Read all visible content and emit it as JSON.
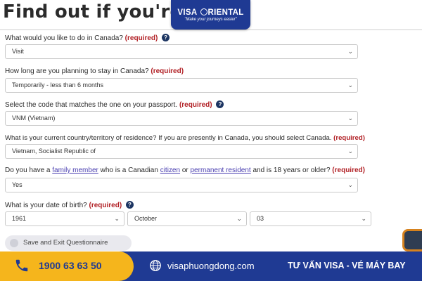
{
  "title": "Find out if you're eligib",
  "logo": {
    "name_part1": "VISA ",
    "name_part2": "RIENTAL",
    "tagline": "\"Make your journeys easier\""
  },
  "required_label": "(required)",
  "questions": [
    {
      "text": "What would you like to do in Canada?",
      "help": true,
      "value": "Visit"
    },
    {
      "text": "How long are you planning to stay in Canada?",
      "help": false,
      "value": "Temporarily - less than 6 months"
    },
    {
      "text": "Select the code that matches the one on your passport.",
      "help": true,
      "value": "VNM (Vietnam)"
    },
    {
      "text": "What is your current country/territory of residence? If you are presently in Canada, you should select Canada.",
      "help": false,
      "value": "Vietnam, Socialist Republic of"
    },
    {
      "text_parts": [
        "Do you have a ",
        "family member",
        " who is a Canadian ",
        "citizen",
        " or ",
        "permanent resident",
        " and is 18 years or older?"
      ],
      "help": false,
      "value": "Yes"
    },
    {
      "text": "What is your date of birth?",
      "help": true,
      "values": [
        "1961",
        "October",
        "03"
      ]
    }
  ],
  "help_glyph": "?",
  "chevron_glyph": "⌄",
  "save_button": "Save and Exit Questionnaire",
  "footer": {
    "phone": "1900 63 63 50",
    "website": "visaphuongdong.com",
    "slogan": "TƯ VẤN VISA - VÉ MÁY BAY"
  },
  "colors": {
    "required": "#b11f24",
    "brand_blue": "#1f3a93",
    "brand_yellow": "#f5b51c",
    "help_icon": "#1c3562",
    "link": "#4a3fb0"
  }
}
